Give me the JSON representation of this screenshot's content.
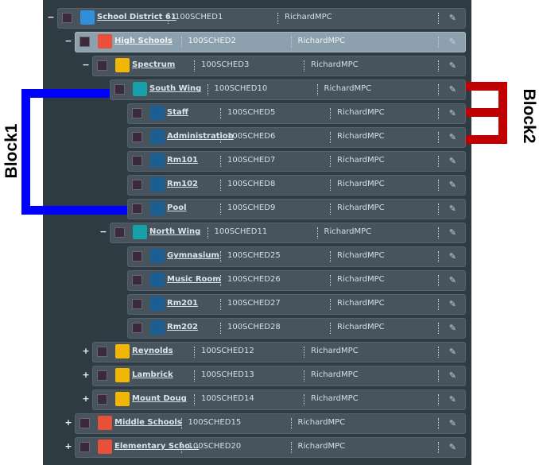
{
  "annotations": {
    "left_label": "Block1",
    "right_label": "Block2",
    "left_color": "#0000ff",
    "right_color": "#c00000"
  },
  "colors": {
    "blue": "#2f8fd8",
    "red": "#e8503a",
    "yellow": "#f2b705",
    "teal": "#16a0a8",
    "darkblue": "#1b5e92"
  },
  "rows": [
    {
      "name": "School District 61",
      "code": "100SCHED1",
      "owner": "RichardMPC",
      "color": "blue",
      "toggle": "−",
      "level": 0
    },
    {
      "name": "High Schools",
      "code": "100SCHED2",
      "owner": "RichardMPC",
      "color": "red",
      "toggle": "−",
      "level": 1,
      "selected": true
    },
    {
      "name": "Spectrum",
      "code": "100SCHED3",
      "owner": "RichardMPC",
      "color": "yellow",
      "toggle": "−",
      "level": 2
    },
    {
      "name": "South Wing",
      "code": "100SCHED10",
      "owner": "RichardMPC",
      "color": "teal",
      "toggle": "",
      "level": 3
    },
    {
      "name": "Staff",
      "code": "100SCHED5",
      "owner": "RichardMPC",
      "color": "darkblue",
      "toggle": "",
      "level": 4
    },
    {
      "name": "Administration",
      "code": "100SCHED6",
      "owner": "RichardMPC",
      "color": "darkblue",
      "toggle": "",
      "level": 4
    },
    {
      "name": "Rm101",
      "code": "100SCHED7",
      "owner": "RichardMPC",
      "color": "darkblue",
      "toggle": "",
      "level": 4
    },
    {
      "name": "Rm102",
      "code": "100SCHED8",
      "owner": "RichardMPC",
      "color": "darkblue",
      "toggle": "",
      "level": 4
    },
    {
      "name": "Pool",
      "code": "100SCHED9",
      "owner": "RichardMPC",
      "color": "darkblue",
      "toggle": "",
      "level": 4
    },
    {
      "name": "North Wing",
      "code": "100SCHED11",
      "owner": "RichardMPC",
      "color": "teal",
      "toggle": "−",
      "level": 3
    },
    {
      "name": "Gymnasium",
      "code": "100SCHED25",
      "owner": "RichardMPC",
      "color": "darkblue",
      "toggle": "",
      "level": 4
    },
    {
      "name": "Music Room",
      "code": "100SCHED26",
      "owner": "RichardMPC",
      "color": "darkblue",
      "toggle": "",
      "level": 4
    },
    {
      "name": "Rm201",
      "code": "100SCHED27",
      "owner": "RichardMPC",
      "color": "darkblue",
      "toggle": "",
      "level": 4
    },
    {
      "name": "Rm202",
      "code": "100SCHED28",
      "owner": "RichardMPC",
      "color": "darkblue",
      "toggle": "",
      "level": 4
    },
    {
      "name": "Reynolds",
      "code": "100SCHED12",
      "owner": "RichardMPC",
      "color": "yellow",
      "toggle": "+",
      "level": 2
    },
    {
      "name": "Lambrick",
      "code": "100SCHED13",
      "owner": "RichardMPC",
      "color": "yellow",
      "toggle": "+",
      "level": 2
    },
    {
      "name": "Mount Doug",
      "code": "100SCHED14",
      "owner": "RichardMPC",
      "color": "yellow",
      "toggle": "+",
      "level": 2
    },
    {
      "name": "Middle Schools",
      "code": "100SCHED15",
      "owner": "RichardMPC",
      "color": "red",
      "toggle": "+",
      "level": 1
    },
    {
      "name": "Elementary Scho...",
      "code": "100SCHED20",
      "owner": "RichardMPC",
      "color": "red",
      "toggle": "+",
      "level": 1
    }
  ]
}
